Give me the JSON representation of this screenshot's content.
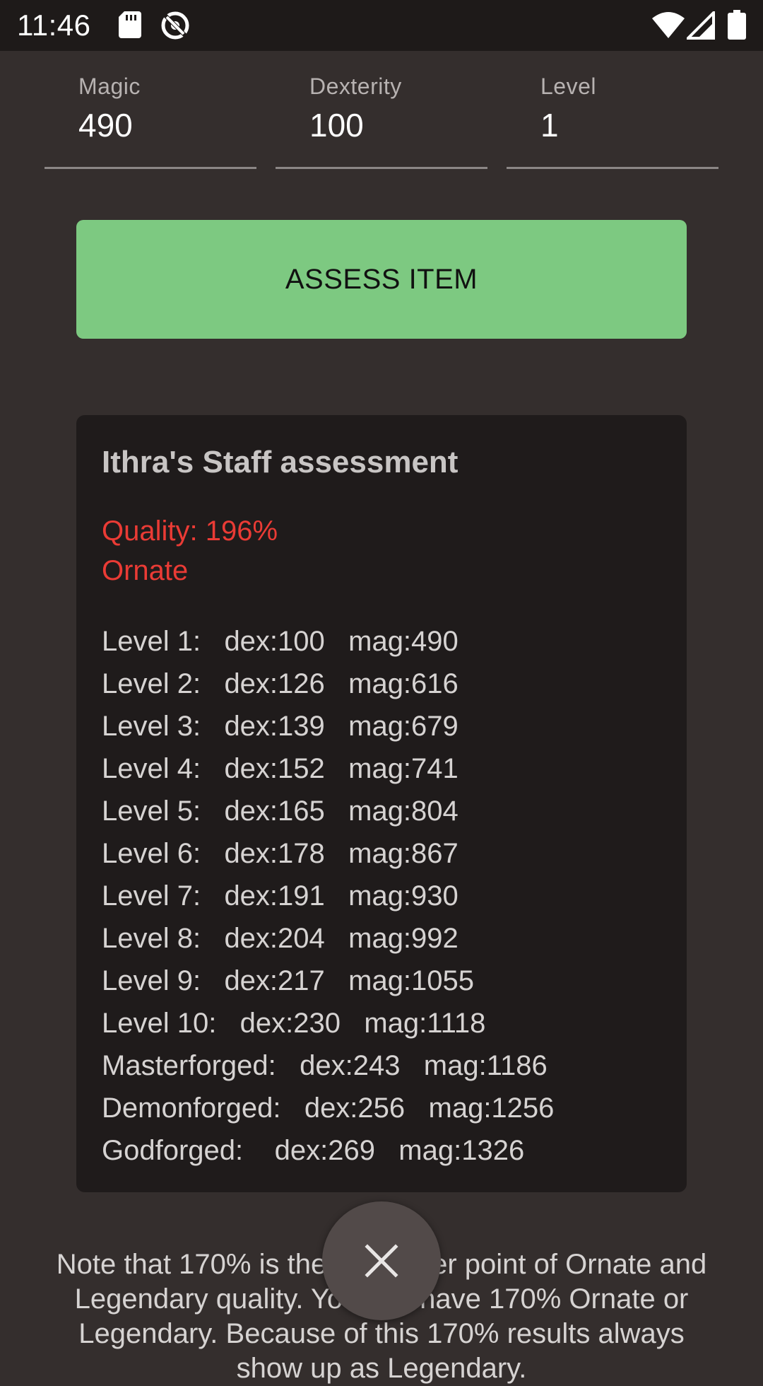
{
  "status_bar": {
    "time": "11:46",
    "icons": [
      "sd-card-icon",
      "sync-icon",
      "wifi-icon",
      "signal-icon",
      "battery-icon"
    ]
  },
  "inputs": {
    "magic": {
      "label": "Magic",
      "value": "490"
    },
    "dexterity": {
      "label": "Dexterity",
      "value": "100"
    },
    "level": {
      "label": "Level",
      "value": "1"
    }
  },
  "assess_button": {
    "label": "ASSESS ITEM",
    "color": "#7dc981"
  },
  "assessment": {
    "title": "Ithra's Staff assessment",
    "quality": "Quality: 196%",
    "tier": "Ornate",
    "quality_color": "#ea3b35",
    "rows": [
      {
        "text": "Level 1:   dex:100   mag:490"
      },
      {
        "text": "Level 2:   dex:126   mag:616"
      },
      {
        "text": "Level 3:   dex:139   mag:679"
      },
      {
        "text": "Level 4:   dex:152   mag:741"
      },
      {
        "text": "Level 5:   dex:165   mag:804"
      },
      {
        "text": "Level 6:   dex:178   mag:867"
      },
      {
        "text": "Level 7:   dex:191   mag:930"
      },
      {
        "text": "Level 8:   dex:204   mag:992"
      },
      {
        "text": "Level 9:   dex:217   mag:1055"
      },
      {
        "text": "Level 10:   dex:230   mag:1118"
      },
      {
        "text": "Masterforged:   dex:243   mag:1186"
      },
      {
        "text": "Demonforged:   dex:256   mag:1256"
      },
      {
        "text": "Godforged:    dex:269   mag:1326"
      }
    ]
  },
  "note": {
    "text": "Note that 170% is the crossover point of Ornate and Legendary quality. You can have 170% Ornate or Legendary. Because of this 170% results always show up as Legendary."
  },
  "close_fab": {
    "icon": "close-icon"
  }
}
